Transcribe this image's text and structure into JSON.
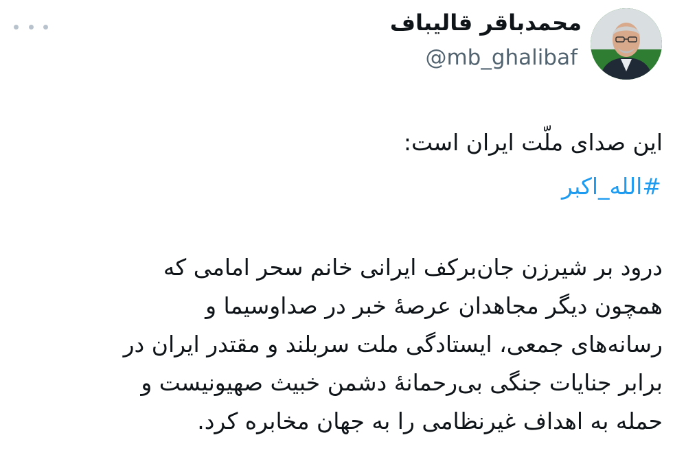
{
  "author": {
    "display_name": "محمدباقر قالیباف",
    "handle": "@mb_ghalibaf",
    "avatar_icon": "profile-photo"
  },
  "menu": {
    "more_icon": "more-horizontal-icon"
  },
  "tweet": {
    "lines": [
      "این صدای ملّت ایران است:"
    ],
    "hashtag": "#الله_اکبر",
    "paragraph_lines": [
      "درود بر شیرزن جان‌برکف ایرانی خانم سحر امامی که",
      "همچون دیگر مجاهدان عرصۀ خبر در صداوسیما و",
      "رسانه‌های جمعی، ایستادگی ملت سربلند و مقتدر ایران در",
      "برابر جنایات جنگی بی‌رحمانۀ دشمن خبیث صهیونیست و",
      "حمله به اهداف غیرنظامی را به جهان مخابره کرد."
    ]
  },
  "colors": {
    "text": "#0f1419",
    "secondary": "#536471",
    "link": "#1d9bf0",
    "avatar_background": "#2e7d32"
  }
}
